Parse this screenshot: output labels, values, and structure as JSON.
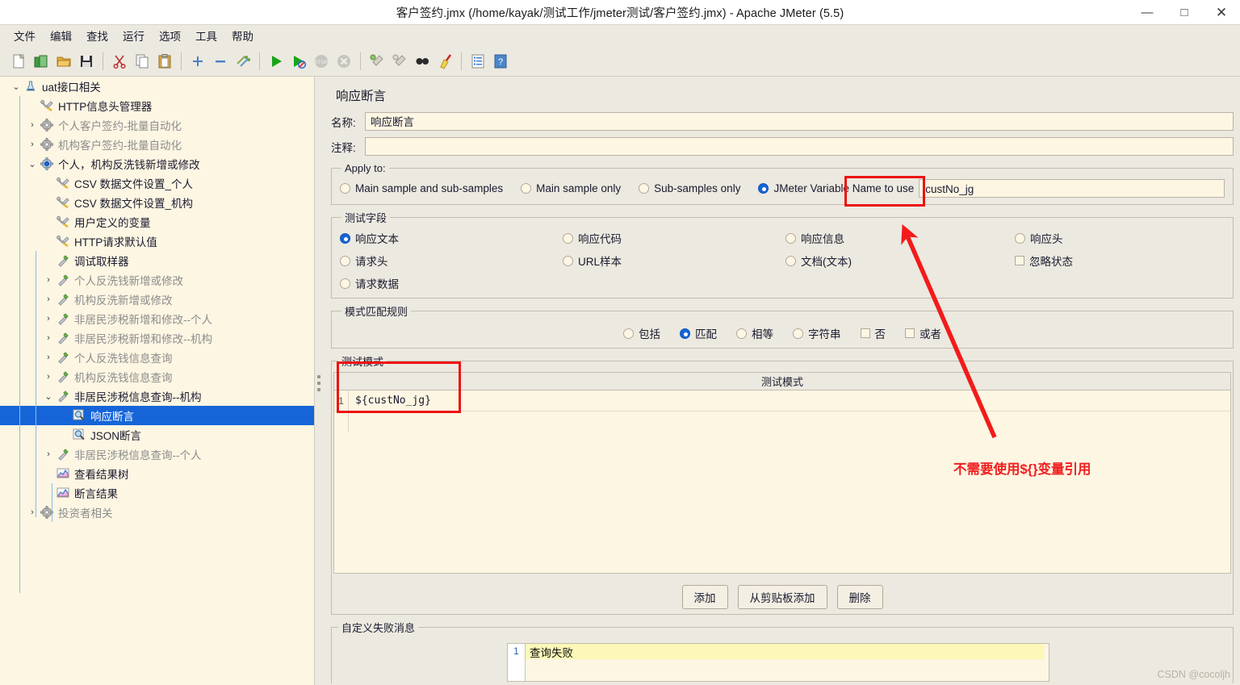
{
  "window": {
    "title": "客户签约.jmx (/home/kayak/测试工作/jmeter测试/客户签约.jmx) - Apache JMeter (5.5)",
    "minimize": "—",
    "maximize": "□",
    "close": "✕"
  },
  "menubar": {
    "items": [
      {
        "label": "文件"
      },
      {
        "label": "编辑"
      },
      {
        "label": "查找"
      },
      {
        "label": "运行"
      },
      {
        "label": "选项"
      },
      {
        "label": "工具"
      },
      {
        "label": "帮助"
      }
    ]
  },
  "toolbar": {
    "items": [
      {
        "name": "new-icon",
        "glyph": "🗋"
      },
      {
        "name": "templates-icon",
        "glyph": "📗"
      },
      {
        "name": "open-icon",
        "glyph": "📂"
      },
      {
        "name": "save-icon",
        "glyph": "💾"
      },
      {
        "name": "cut-icon",
        "glyph": "✂"
      },
      {
        "name": "copy-icon",
        "glyph": "🗐"
      },
      {
        "name": "paste-icon",
        "glyph": "📋"
      },
      {
        "name": "expand-icon",
        "glyph": "✚"
      },
      {
        "name": "collapse-icon",
        "glyph": "▬"
      },
      {
        "name": "toggle-icon",
        "glyph": "⇄"
      },
      {
        "name": "start-icon",
        "glyph": "▶"
      },
      {
        "name": "start-no-pauses-icon",
        "glyph": "▶"
      },
      {
        "name": "stop-icon",
        "glyph": "⏹"
      },
      {
        "name": "shutdown-icon",
        "glyph": "✖"
      },
      {
        "name": "clear-icon",
        "glyph": "🧹"
      },
      {
        "name": "clear-all-icon",
        "glyph": "🧹"
      },
      {
        "name": "search-icon",
        "glyph": "🔍"
      },
      {
        "name": "reset-search-icon",
        "glyph": "🧽"
      },
      {
        "name": "function-helper-icon",
        "glyph": "🗒"
      },
      {
        "name": "help-icon",
        "glyph": "?"
      }
    ]
  },
  "tree": {
    "nodes": [
      {
        "label": "uat接口相关",
        "indent": 0,
        "twist": "v",
        "icon": "testplan",
        "dim": false,
        "selected": false
      },
      {
        "label": "HTTP信息头管理器",
        "indent": 1,
        "twist": "",
        "icon": "config",
        "dim": false,
        "selected": false
      },
      {
        "label": "个人客户签约-批量自动化",
        "indent": 1,
        "twist": ">",
        "icon": "gear",
        "dim": true,
        "selected": false
      },
      {
        "label": "机构客户签约-批量自动化",
        "indent": 1,
        "twist": ">",
        "icon": "gear",
        "dim": true,
        "selected": false
      },
      {
        "label": "个人，机构反洗钱新增或修改",
        "indent": 1,
        "twist": "v",
        "icon": "gear-on",
        "dim": false,
        "selected": false
      },
      {
        "label": "CSV 数据文件设置_个人",
        "indent": 2,
        "twist": "",
        "icon": "config",
        "dim": false,
        "selected": false
      },
      {
        "label": "CSV 数据文件设置_机构",
        "indent": 2,
        "twist": "",
        "icon": "config",
        "dim": false,
        "selected": false
      },
      {
        "label": "用户定义的变量",
        "indent": 2,
        "twist": "",
        "icon": "config",
        "dim": false,
        "selected": false
      },
      {
        "label": "HTTP请求默认值",
        "indent": 2,
        "twist": "",
        "icon": "config",
        "dim": false,
        "selected": false
      },
      {
        "label": "调试取样器",
        "indent": 2,
        "twist": "",
        "icon": "sampler",
        "dim": false,
        "selected": false
      },
      {
        "label": "个人反洗钱新增或修改",
        "indent": 2,
        "twist": ">",
        "icon": "sampler",
        "dim": true,
        "selected": false
      },
      {
        "label": "机构反洗新增或修改",
        "indent": 2,
        "twist": ">",
        "icon": "sampler",
        "dim": true,
        "selected": false
      },
      {
        "label": "非居民涉税新增和修改--个人",
        "indent": 2,
        "twist": ">",
        "icon": "sampler",
        "dim": true,
        "selected": false
      },
      {
        "label": "非居民涉税新增和修改--机构",
        "indent": 2,
        "twist": ">",
        "icon": "sampler",
        "dim": true,
        "selected": false
      },
      {
        "label": "个人反洗钱信息查询",
        "indent": 2,
        "twist": ">",
        "icon": "sampler",
        "dim": true,
        "selected": false
      },
      {
        "label": "机构反洗钱信息查询",
        "indent": 2,
        "twist": ">",
        "icon": "sampler",
        "dim": true,
        "selected": false
      },
      {
        "label": "非居民涉税信息查询--机构",
        "indent": 2,
        "twist": "v",
        "icon": "sampler",
        "dim": false,
        "selected": false
      },
      {
        "label": "响应断言",
        "indent": 3,
        "twist": "",
        "icon": "assert",
        "dim": false,
        "selected": true
      },
      {
        "label": "JSON断言",
        "indent": 3,
        "twist": "",
        "icon": "assert",
        "dim": false,
        "selected": false
      },
      {
        "label": "非居民涉税信息查询--个人",
        "indent": 2,
        "twist": ">",
        "icon": "sampler",
        "dim": true,
        "selected": false
      },
      {
        "label": "查看结果树",
        "indent": 2,
        "twist": "",
        "icon": "listener",
        "dim": false,
        "selected": false
      },
      {
        "label": "断言结果",
        "indent": 2,
        "twist": "",
        "icon": "listener",
        "dim": false,
        "selected": false
      },
      {
        "label": "投资者相关",
        "indent": 1,
        "twist": ">",
        "icon": "gear",
        "dim": true,
        "selected": false
      }
    ]
  },
  "assertion": {
    "panel_title": "响应断言",
    "name_label": "名称:",
    "name_value": "响应断言",
    "comment_label": "注释:",
    "comment_value": "",
    "apply_to": {
      "legend": "Apply to:",
      "options": [
        {
          "label": "Main sample and sub-samples",
          "selected": false
        },
        {
          "label": "Main sample only",
          "selected": false
        },
        {
          "label": "Sub-samples only",
          "selected": false
        },
        {
          "label": "JMeter Variable Name to use",
          "selected": true
        }
      ],
      "variable_value": "custNo_jg"
    },
    "test_field": {
      "legend": "测试字段",
      "options": [
        {
          "label": "响应文本",
          "selected": true,
          "type": "radio"
        },
        {
          "label": "响应代码",
          "selected": false,
          "type": "radio"
        },
        {
          "label": "响应信息",
          "selected": false,
          "type": "radio"
        },
        {
          "label": "响应头",
          "selected": false,
          "type": "radio"
        },
        {
          "label": "请求头",
          "selected": false,
          "type": "radio"
        },
        {
          "label": "URL样本",
          "selected": false,
          "type": "radio"
        },
        {
          "label": "文档(文本)",
          "selected": false,
          "type": "radio"
        },
        {
          "label": "忽略状态",
          "selected": false,
          "type": "checkbox"
        },
        {
          "label": "请求数据",
          "selected": false,
          "type": "radio"
        }
      ]
    },
    "pattern_rules": {
      "legend": "模式匹配规则",
      "options": [
        {
          "label": "包括",
          "selected": false,
          "type": "radio"
        },
        {
          "label": "匹配",
          "selected": true,
          "type": "radio"
        },
        {
          "label": "相等",
          "selected": false,
          "type": "radio"
        },
        {
          "label": "字符串",
          "selected": false,
          "type": "radio"
        },
        {
          "label": "否",
          "selected": false,
          "type": "checkbox"
        },
        {
          "label": "或者",
          "selected": false,
          "type": "checkbox"
        }
      ]
    },
    "test_patterns": {
      "legend": "测试模式",
      "column_header": "测试模式",
      "rows": [
        {
          "num": "1",
          "value": "${custNo_jg}"
        }
      ]
    },
    "buttons": {
      "add": "添加",
      "add_from_clipboard": "从剪贴板添加",
      "delete": "删除"
    },
    "custom_message": {
      "legend": "自定义失败消息",
      "rows": [
        {
          "num": "1",
          "value": "查询失败"
        }
      ]
    }
  },
  "annotations": {
    "note_text": "不需要使用${}变量引用",
    "accent_red": "#ee1111"
  },
  "watermark": "CSDN @cocoljh"
}
